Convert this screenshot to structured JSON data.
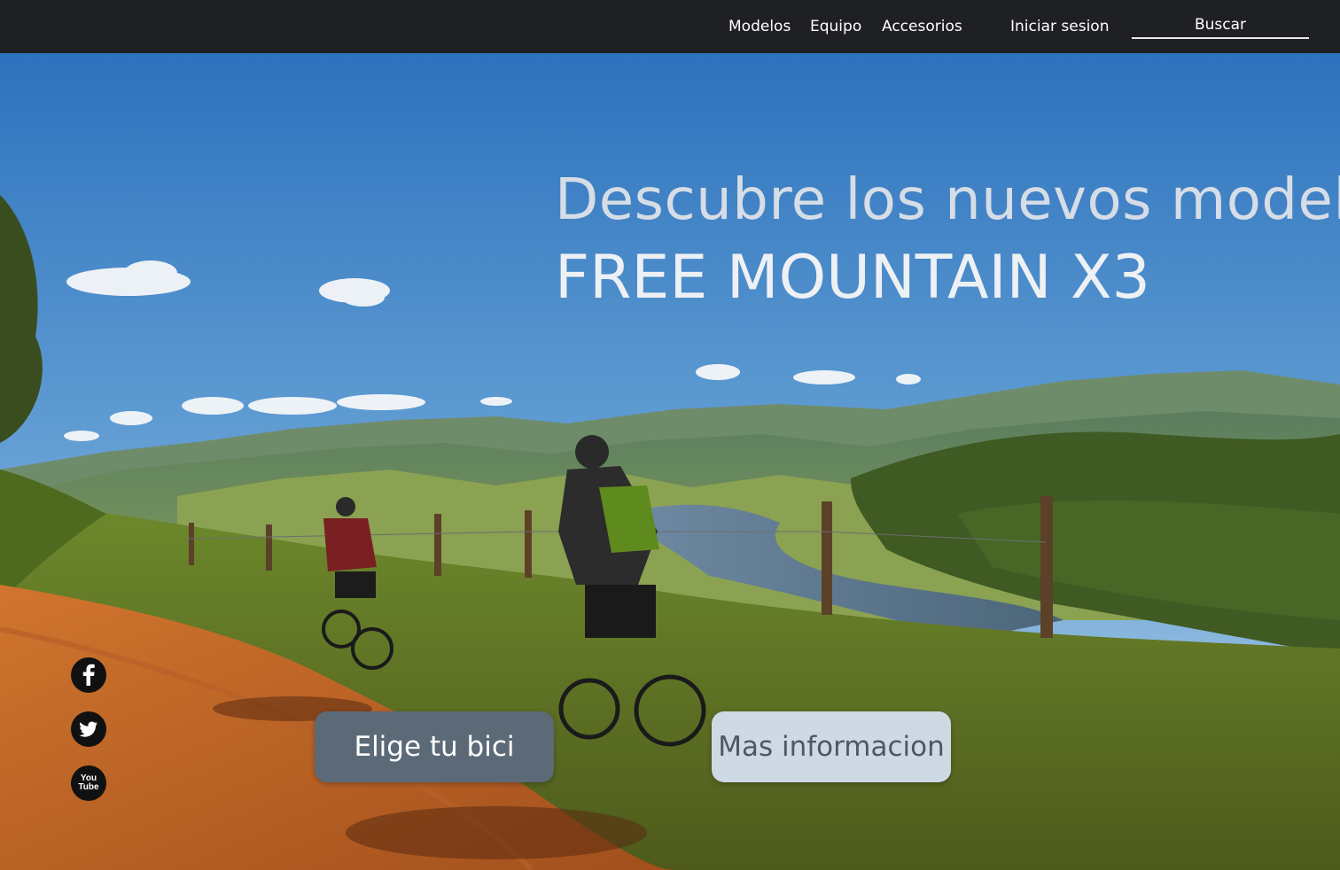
{
  "nav": {
    "links": [
      "Modelos",
      "Equipo",
      "Accesorios"
    ],
    "login_label": "Iniciar sesion",
    "search_placeholder": "Buscar"
  },
  "hero": {
    "headline_line1": "Descubre los nuevos modelos",
    "headline_line2": "FREE MOUNTAIN  X3",
    "primary_button": "Elige tu bici",
    "secondary_button": "Mas informacion"
  },
  "social": {
    "youtube_text_1": "You",
    "youtube_text_2": "Tube"
  },
  "colors": {
    "topbar": "#1f2023",
    "primary_button": "#5c6a78",
    "secondary_button": "#cfd9e4"
  }
}
